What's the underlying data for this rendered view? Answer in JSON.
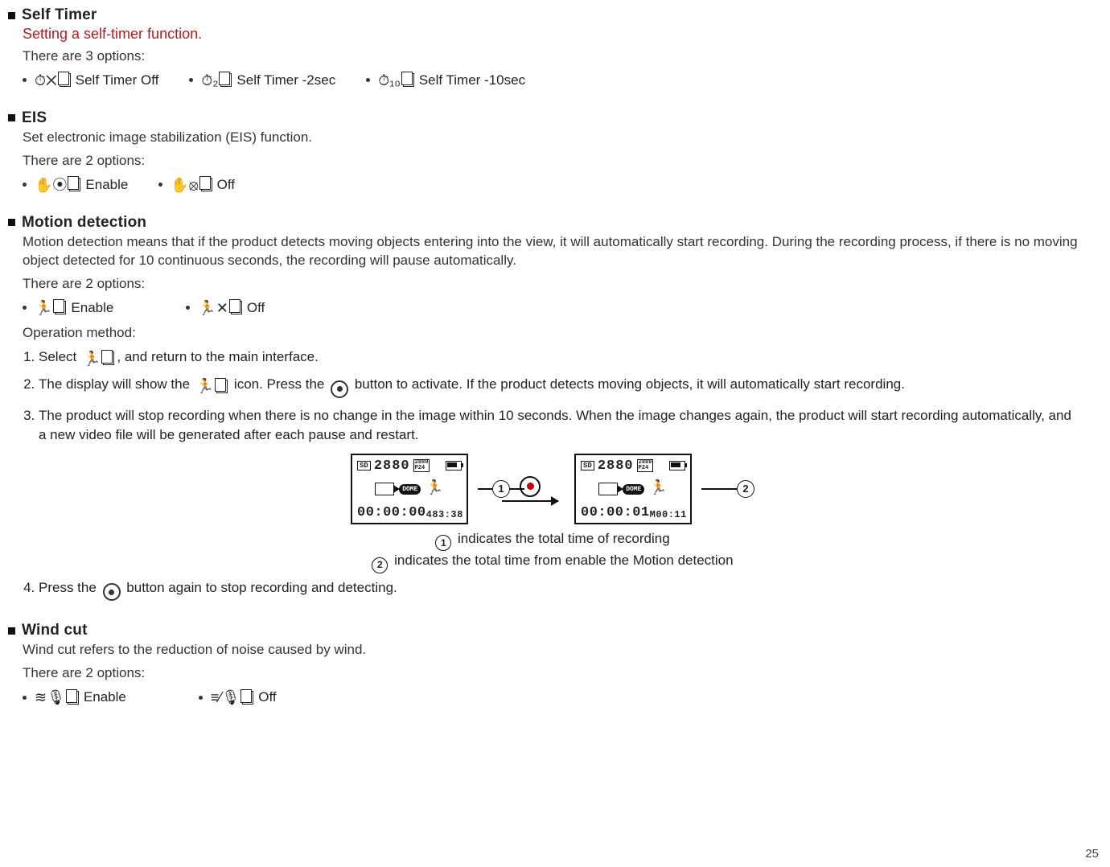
{
  "page_number": "25",
  "sections": {
    "self_timer": {
      "title": "Self Timer",
      "subtitle": "Setting a self-timer function.",
      "intro": "There are 3 options:",
      "options": [
        "Self Timer Off",
        "Self Timer -2sec",
        "Self Timer -10sec"
      ]
    },
    "eis": {
      "title": "EIS",
      "desc": "Set electronic image stabilization (EIS) function.",
      "intro": "There are 2 options:",
      "options": [
        "Enable",
        "Off"
      ]
    },
    "motion": {
      "title": "Motion detection",
      "desc": "Motion detection means that if the product detects moving objects entering into the view, it will automatically start recording. During the recording process, if there is no moving object detected for 10 continuous seconds, the recording will pause automatically.",
      "intro": "There are 2 options:",
      "options": [
        "Enable",
        "Off"
      ],
      "op_method_label": "Operation method:",
      "steps": {
        "s1a": "Select",
        "s1b": ", and return to the main interface.",
        "s2a": "The display will show the",
        "s2b": "icon. Press the",
        "s2c": "button to activate. If the product detects moving objects, it will automatically start recording.",
        "s3": "The product will stop recording when there is no change in the image within 10 seconds. When the image changes again, the product will start recording automatically, and a new video file will be generated after each pause and restart.",
        "s4a": "Press the",
        "s4b": "button again to stop recording and detecting."
      },
      "diagram": {
        "lcd_top_res": "2880",
        "lcd_badge_top": "2880",
        "lcd_badge_bot": "P24",
        "sd": "SD",
        "dome": "DOME",
        "left_time": "00:00:00",
        "left_small": "483:38",
        "right_time": "00:00:01",
        "right_small": "M00:11",
        "legend1": "indicates the total time of recording",
        "legend2": "indicates the total time from enable the Motion detection",
        "n1": "1",
        "n2": "2"
      }
    },
    "wind": {
      "title": "Wind cut",
      "desc": "Wind cut refers to the reduction of noise caused by wind.",
      "intro": "There are 2 options:",
      "options": [
        "Enable",
        "Off"
      ]
    }
  }
}
